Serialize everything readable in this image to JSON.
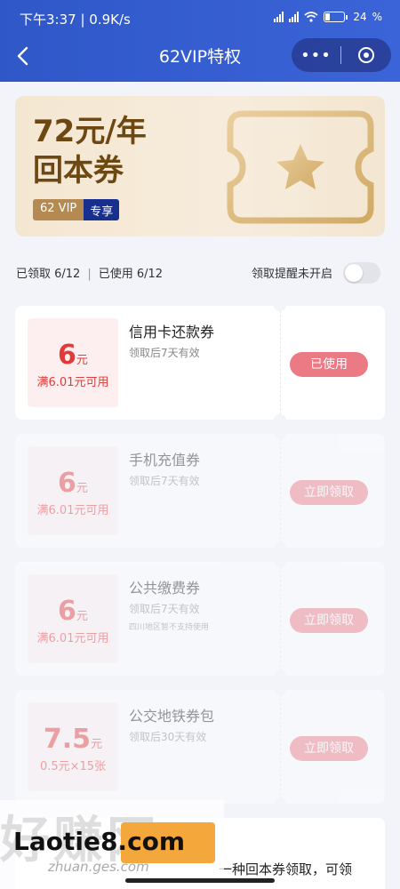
{
  "status_bar": {
    "time": "下午3:37 | 0.9K/s",
    "battery": "24"
  },
  "nav": {
    "title": "62VIP特权",
    "more_label": "•••",
    "back_icon": "back-chevron-icon",
    "close_icon": "close-circle-icon"
  },
  "banner": {
    "title_line1": "72元/年",
    "title_line2": "回本券",
    "badge_vip": "62 VIP",
    "badge_exclusive": "专享",
    "colors": {
      "title": "#6d4813",
      "vip_badge": "#b48a52",
      "exclusive_badge": "#17308f"
    }
  },
  "stats": {
    "claimed": "已领取 6/12",
    "divider": "|",
    "used": "已使用 6/12"
  },
  "reminder": {
    "label": "领取提醒未开启",
    "enabled": false
  },
  "coupons": [
    {
      "amount": "6",
      "unit": "元",
      "condition": "满6.01元可用",
      "name": "信用卡还款券",
      "validity": "领取后7天有效",
      "note": "",
      "button": "已使用",
      "dimmed": false
    },
    {
      "amount": "6",
      "unit": "元",
      "condition": "满6.01元可用",
      "name": "手机充值券",
      "validity": "领取后7天有效",
      "note": "",
      "button": "立即领取",
      "dimmed": true
    },
    {
      "amount": "6",
      "unit": "元",
      "condition": "满6.01元可用",
      "name": "公共缴费券",
      "validity": "领取后7天有效",
      "note": "四川地区暂不支持使用",
      "button": "立即领取",
      "dimmed": true
    },
    {
      "amount": "7.5",
      "unit": "元",
      "condition": "0.5元×15张",
      "name": "公交地铁券包",
      "validity": "领取后30天有效",
      "note": "",
      "button": "立即领取",
      "dimmed": true
    }
  ],
  "bottom": {
    "text": "一种回本券领取，可领"
  },
  "watermark": {
    "big": "好赚网",
    "main": "Laotie8.com",
    "sub": "zhuan.ges.com"
  },
  "accent": {
    "header": "#2f57c8",
    "coupon_red": "#e23a3a",
    "button_pink": "#ec7a84"
  }
}
